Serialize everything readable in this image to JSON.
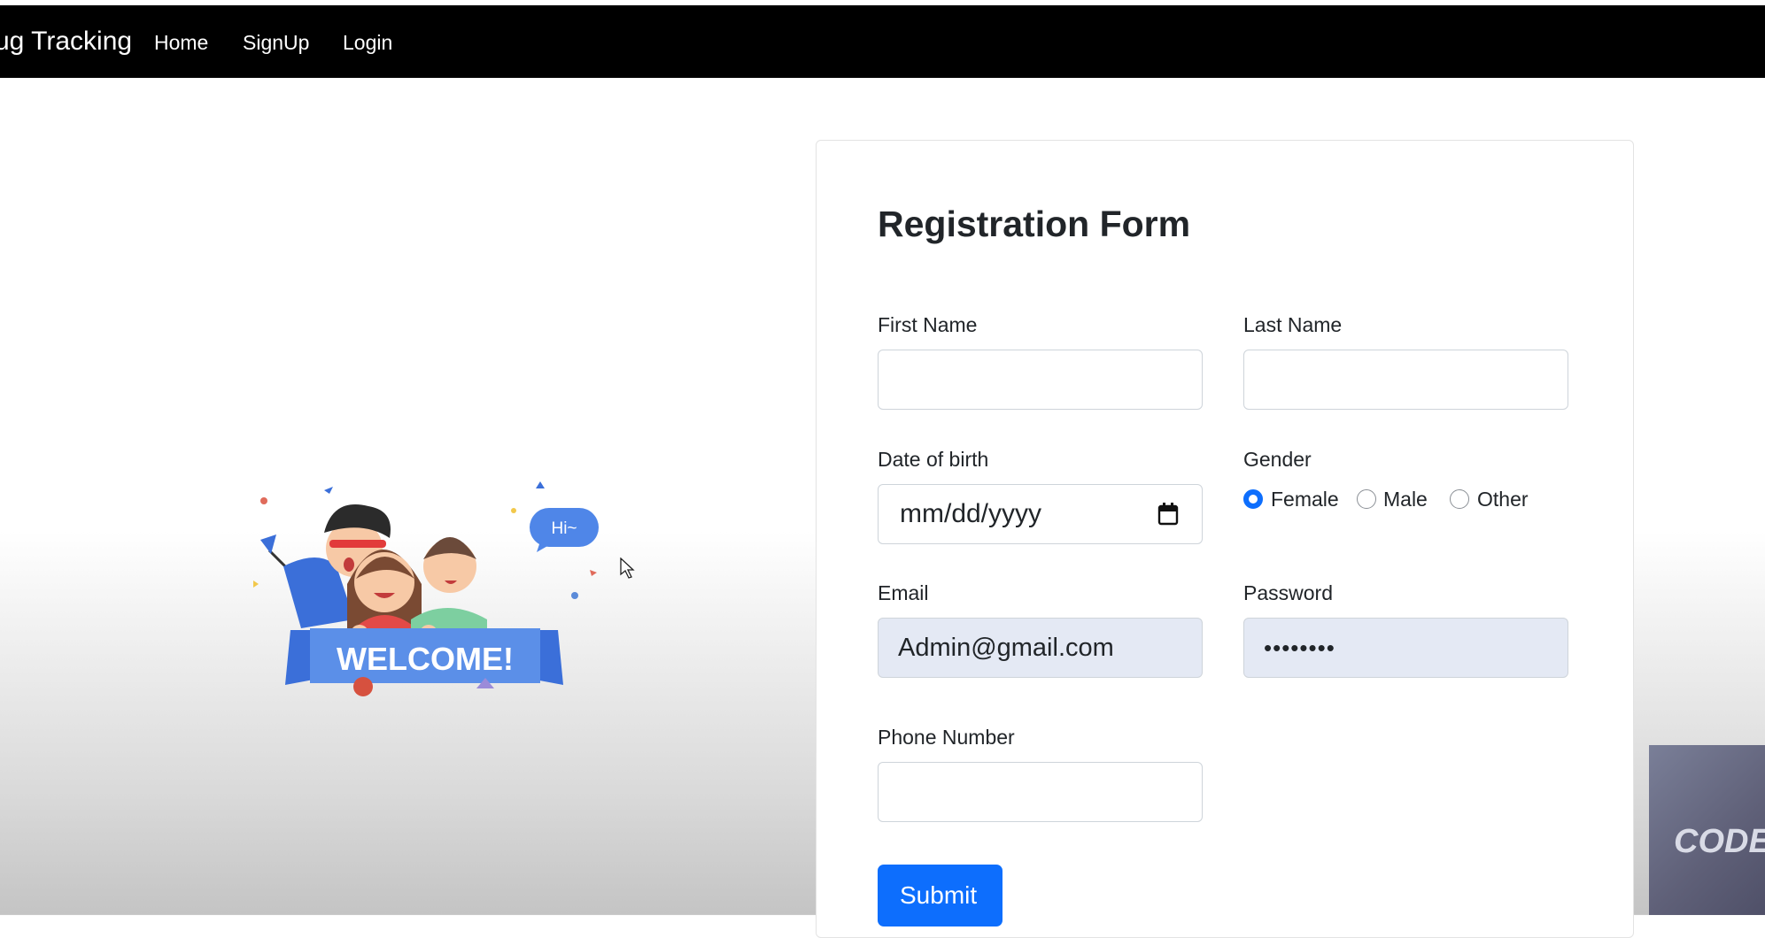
{
  "nav": {
    "brand": "ug Tracking",
    "links": [
      "Home",
      "SignUp",
      "Login"
    ]
  },
  "illustration": {
    "banner_text": "WELCOME!",
    "bubble_text": "Hi~"
  },
  "form": {
    "title": "Registration Form",
    "first_name": {
      "label": "First Name",
      "value": ""
    },
    "last_name": {
      "label": "Last Name",
      "value": ""
    },
    "dob": {
      "label": "Date of birth",
      "placeholder": "mm/dd/yyyy"
    },
    "gender": {
      "label": "Gender",
      "options": [
        "Female",
        "Male",
        "Other"
      ],
      "selected": "Female"
    },
    "email": {
      "label": "Email",
      "value": "Admin@gmail.com"
    },
    "password": {
      "label": "Password",
      "value": "••••••••"
    },
    "phone": {
      "label": "Phone Number",
      "value": ""
    },
    "submit_label": "Submit"
  },
  "overlay": {
    "text": "CODE"
  },
  "colors": {
    "primary": "#0d6efd",
    "navbar": "#000000",
    "autofill": "#e4e9f4"
  }
}
